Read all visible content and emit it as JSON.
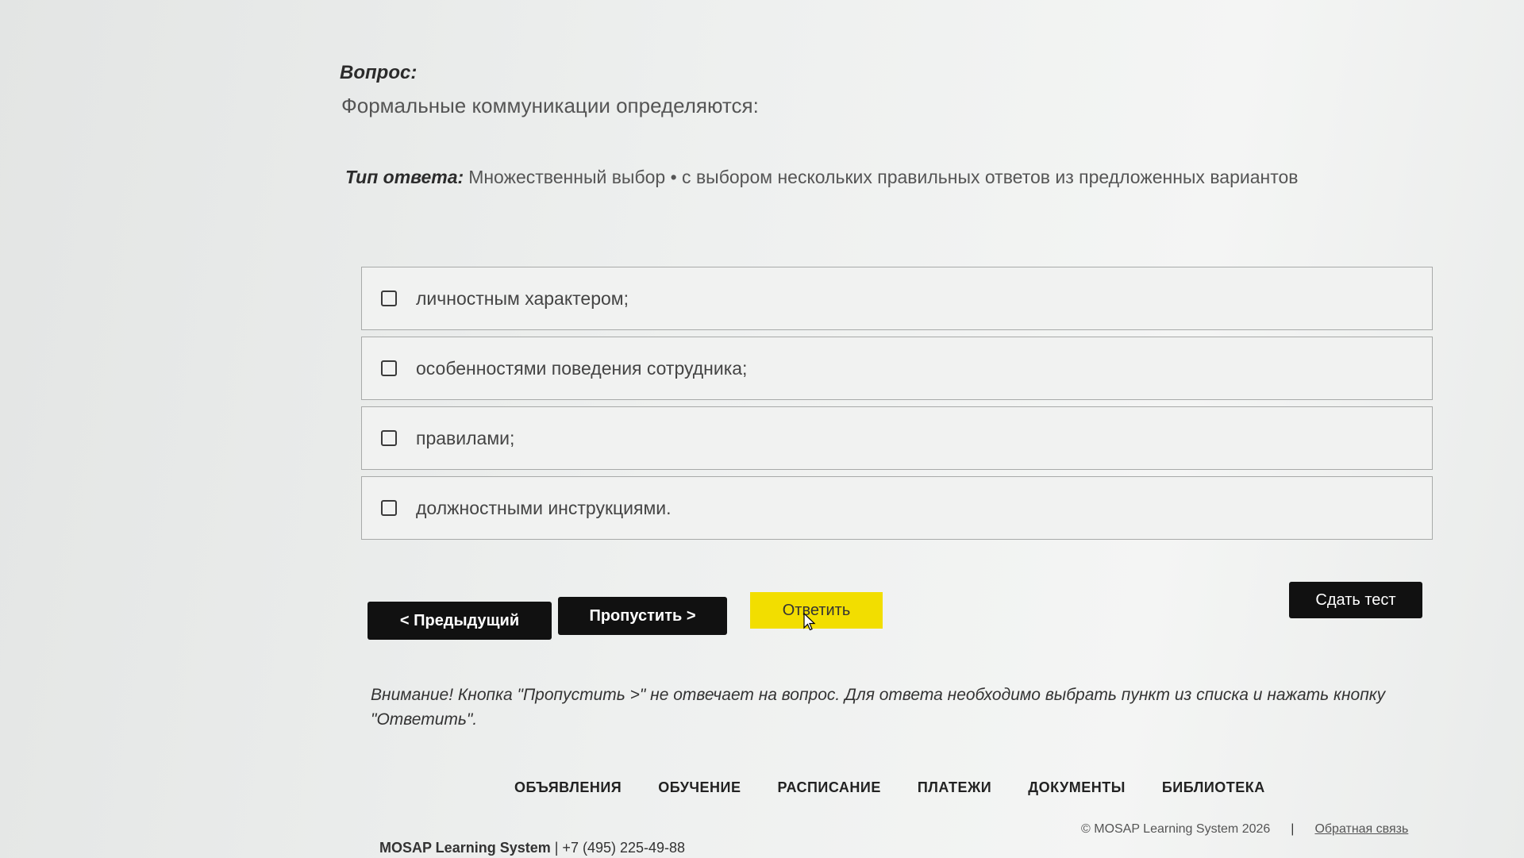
{
  "question": {
    "label": "Вопрос:",
    "text": "Формальные коммуникации определяются:"
  },
  "answer_type": {
    "label": "Тип ответа:",
    "value": "Множественный выбор • с выбором нескольких правильных ответов из предложенных вариантов"
  },
  "options": [
    {
      "label": "личностным характером;",
      "checked": false
    },
    {
      "label": "особенностями поведения сотрудника;",
      "checked": false
    },
    {
      "label": "правилами;",
      "checked": false
    },
    {
      "label": "должностными инструкциями.",
      "checked": false
    }
  ],
  "buttons": {
    "prev": "< Предыдущий",
    "skip": "Пропустить >",
    "answer": "Ответить",
    "submit": "Сдать тест"
  },
  "notice": "Внимание! Кнопка \"Пропустить >\" не отвечает на вопрос. Для ответа необходимо выбрать пункт из списка и нажать кнопку \"Ответить\".",
  "nav": {
    "items": [
      "ОБЪЯВЛЕНИЯ",
      "ОБУЧЕНИЕ",
      "РАСПИСАНИЕ",
      "ПЛАТЕЖИ",
      "ДОКУМЕНТЫ",
      "БИБЛИОТЕКА"
    ]
  },
  "footer": {
    "brand": "MOSAP Learning System",
    "phone": "| +7 (495) 225-49-88",
    "copyright": "© MOSAP Learning System 2026",
    "separator": "|",
    "feedback": "Обратная связь"
  },
  "colors": {
    "accent_yellow": "#f2de00",
    "button_dark": "#111111"
  }
}
